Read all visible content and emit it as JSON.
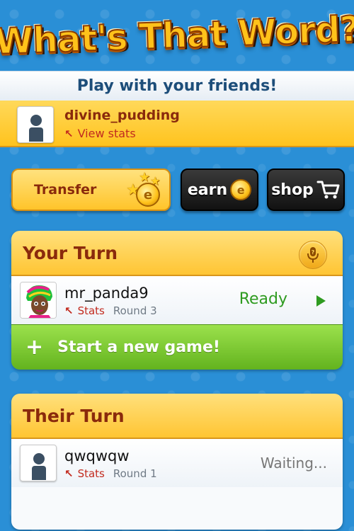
{
  "app": {
    "logo_text": "What's That Word?",
    "tagline": "Play with your friends!"
  },
  "user": {
    "username": "divine_pudding",
    "view_stats_label": "View stats"
  },
  "actions": {
    "transfer_label": "Transfer",
    "earn_label": "earn",
    "shop_label": "shop",
    "coin_glyph": "e"
  },
  "your_turn": {
    "title": "Your Turn",
    "games": [
      {
        "player": "mr_panda9",
        "stats_label": "Stats",
        "round": "Round 3",
        "status": "Ready"
      }
    ],
    "new_game_label": "Start a new game!"
  },
  "their_turn": {
    "title": "Their Turn",
    "games": [
      {
        "player": "qwqwqw",
        "stats_label": "Stats",
        "round": "Round 1",
        "status": "Waiting..."
      }
    ]
  },
  "colors": {
    "background": "#2a8fd6",
    "header_gold": "#ffc533",
    "title_brown": "#8a2a0c",
    "link_red": "#c22b1f",
    "ready_green": "#2e9b20",
    "new_game_green": "#63b31e"
  },
  "icons": [
    "user-silhouette-icon",
    "arrow-up-left-icon",
    "coin-icon",
    "star-icon",
    "shopping-cart-icon",
    "microphone-icon",
    "play-icon",
    "plus-icon"
  ]
}
